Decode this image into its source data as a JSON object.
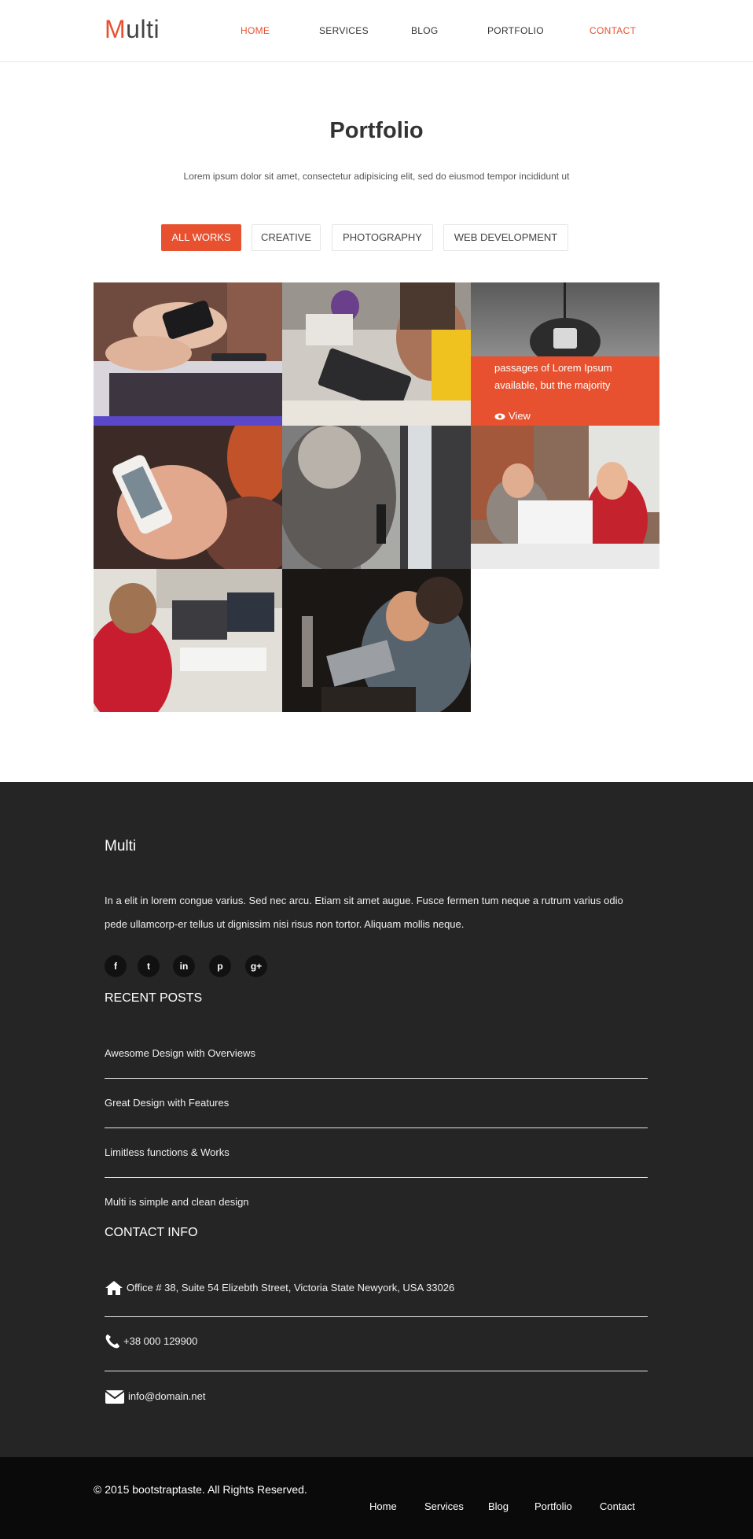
{
  "header": {
    "logo_first": "M",
    "logo_rest": "ulti",
    "nav": [
      {
        "label": "HOME"
      },
      {
        "label": "SERVICES"
      },
      {
        "label": "BLOG"
      },
      {
        "label": "PORTFOLIO"
      },
      {
        "label": "CONTACT"
      }
    ]
  },
  "portfolio": {
    "title": "Portfolio",
    "subtitle": "Lorem ipsum dolor sit amet, consectetur adipisicing elit, sed do eiusmod tempor incididunt ut",
    "filters": [
      {
        "label": "ALL WORKS"
      },
      {
        "label": "CREATIVE"
      },
      {
        "label": "PHOTOGRAPHY"
      },
      {
        "label": "WEB DEVELOPMENT"
      }
    ],
    "hover_text": "passages of Lorem Ipsum available, but the majority",
    "hover_view": "View"
  },
  "footer": {
    "brand": "Multi",
    "about": "In a elit in lorem congue varius. Sed nec arcu. Etiam sit amet augue. Fusce fermen tum neque a rutrum varius odio pede ullamcorp-er tellus ut dignissim nisi risus non tortor. Aliquam mollis neque.",
    "social": [
      "f",
      "t",
      "in",
      "p",
      "g+"
    ],
    "recent_title": "RECENT POSTS",
    "posts": [
      "Awesome Design with Overviews",
      "Great Design with Features",
      "Limitless functions & Works",
      "Multi is simple and clean design"
    ],
    "contact_title": "CONTACT INFO",
    "address": "Office # 38, Suite 54 Elizebth Street, Victoria State Newyork, USA 33026",
    "phone": "+38 000 129900",
    "email": "info@domain.net"
  },
  "bottom": {
    "copyright": "© 2015 bootstraptaste. All Rights Reserved.",
    "links": [
      "Home",
      "Services",
      "Blog",
      "Portfolio",
      "Contact"
    ]
  },
  "colors": {
    "accent": "#e8512f",
    "footer_bg": "#252525",
    "bottom_bg": "#0a0a0a"
  }
}
